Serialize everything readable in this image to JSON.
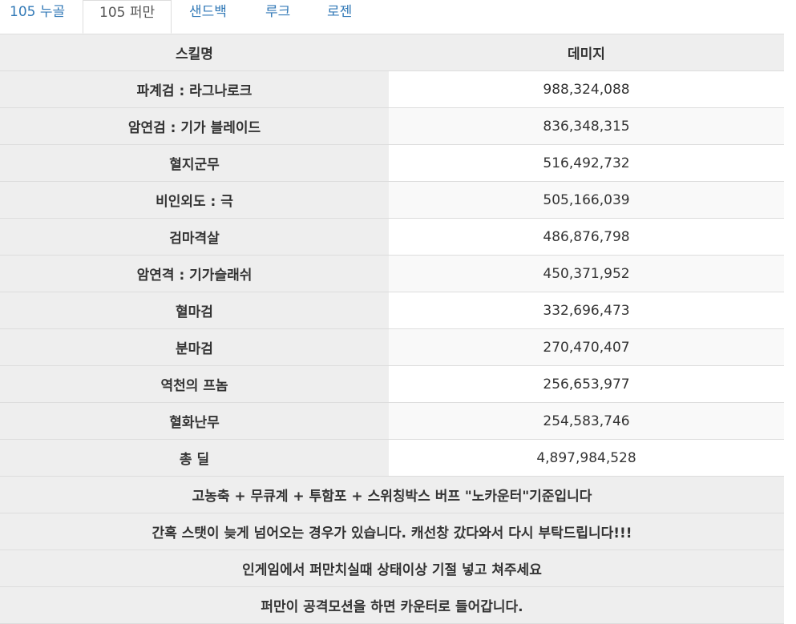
{
  "tabs": [
    {
      "label": "105 누골",
      "active": false
    },
    {
      "label": "105 퍼만",
      "active": true
    },
    {
      "label": "샌드백",
      "active": false
    },
    {
      "label": "루크",
      "active": false
    },
    {
      "label": "로젠",
      "active": false
    }
  ],
  "table": {
    "headers": [
      "스킬명",
      "데미지"
    ],
    "rows": [
      {
        "name": "파계검 : 라그나로크",
        "damage": "988,324,088"
      },
      {
        "name": "암연검 : 기가 블레이드",
        "damage": "836,348,315"
      },
      {
        "name": "혈지군무",
        "damage": "516,492,732"
      },
      {
        "name": "비인외도 : 극",
        "damage": "505,166,039"
      },
      {
        "name": "검마격살",
        "damage": "486,876,798"
      },
      {
        "name": "암연격 : 기가슬래쉬",
        "damage": "450,371,952"
      },
      {
        "name": "혈마검",
        "damage": "332,696,473"
      },
      {
        "name": "분마검",
        "damage": "270,470,407"
      },
      {
        "name": "역천의 프놈",
        "damage": "256,653,977"
      },
      {
        "name": "혈화난무",
        "damage": "254,583,746"
      },
      {
        "name": "총 딜",
        "damage": "4,897,984,528"
      }
    ],
    "notes": [
      "고농축 + 무큐계 + 투함포 + 스위칭박스 버프 \"노카운터\"기준입니다",
      "간혹 스탯이 늦게 넘어오는 경우가 있습니다. 캐선창 갔다와서 다시 부탁드립니다!!!",
      "인게임에서 퍼만치실때 상태이상 기절 넣고 쳐주세요",
      "퍼만이 공격모션을 하면 카운터로 들어갑니다."
    ]
  },
  "colors": {
    "link": "#337ab7",
    "header_bg": "#eeeeee",
    "border": "#dddddd",
    "stripe": "#f9f9f9"
  }
}
